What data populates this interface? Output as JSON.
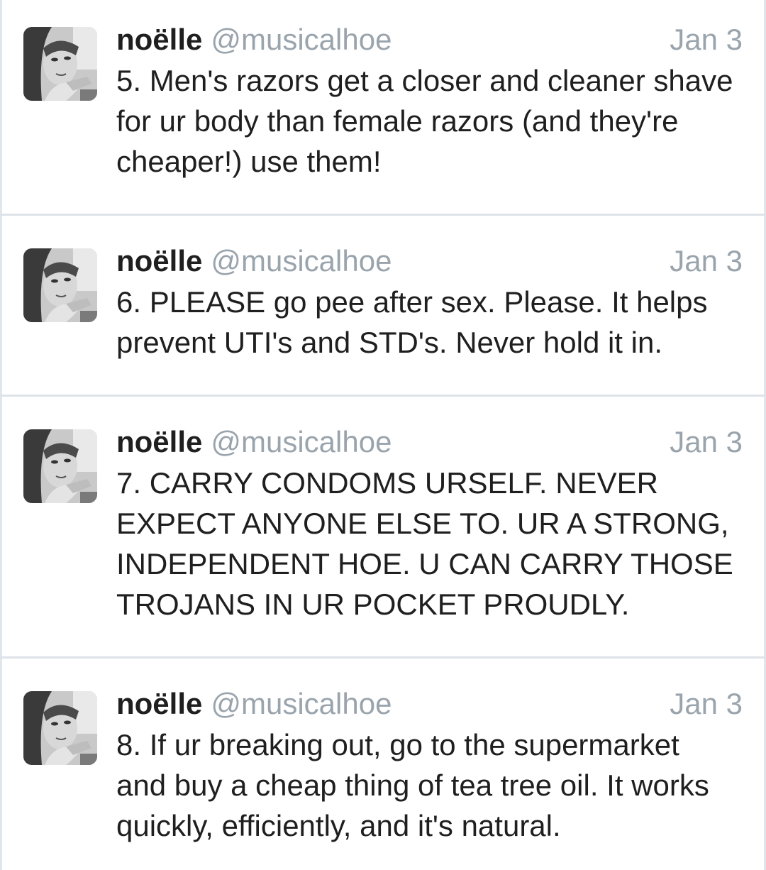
{
  "tweets": [
    {
      "display_name": "noëlle",
      "handle": "@musicalhoe",
      "date": "Jan 3",
      "text": "5. Men's razors get a closer and cleaner shave for ur body than female razors (and they're cheaper!) use them!"
    },
    {
      "display_name": "noëlle",
      "handle": "@musicalhoe",
      "date": "Jan 3",
      "text": "6. PLEASE go pee after sex. Please. It helps prevent UTI's and STD's. Never hold it in."
    },
    {
      "display_name": "noëlle",
      "handle": "@musicalhoe",
      "date": "Jan 3",
      "text": "7. CARRY CONDOMS URSELF. NEVER EXPECT ANYONE ELSE TO. UR A STRONG, INDEPENDENT HOE. U CAN CARRY THOSE TROJANS IN UR POCKET PROUDLY."
    },
    {
      "display_name": "noëlle",
      "handle": "@musicalhoe",
      "date": "Jan 3",
      "text": "8. If ur breaking out, go to the supermarket and buy a cheap thing of tea tree oil. It works quickly, efficiently, and it's natural."
    }
  ],
  "colors": {
    "name": "#1f1f1f",
    "meta": "#9aa4ad",
    "divider": "#dde3e8",
    "background": "#ffffff"
  },
  "icons": {
    "avatar": "profile-photo-grayscale"
  }
}
